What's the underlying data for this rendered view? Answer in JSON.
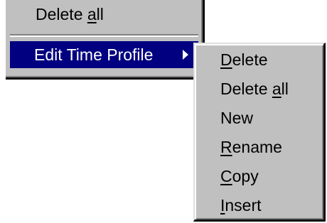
{
  "main_menu": {
    "delete_all": {
      "pre": "Delete ",
      "accel": "a",
      "post": "ll"
    },
    "edit_time_profile": {
      "label": "Edit Time Profile"
    }
  },
  "submenu": {
    "items": [
      {
        "pre": "",
        "accel": "D",
        "post": "elete"
      },
      {
        "pre": "Delete ",
        "accel": "a",
        "post": "ll"
      },
      {
        "pre": "New",
        "accel": "",
        "post": ""
      },
      {
        "pre": "",
        "accel": "R",
        "post": "ename"
      },
      {
        "pre": "",
        "accel": "C",
        "post": "opy"
      },
      {
        "pre": "",
        "accel": "I",
        "post": "nsert"
      }
    ]
  },
  "colors": {
    "menu_bg": "#c0c0c0",
    "highlight_bg": "#000080",
    "highlight_text": "#ffffff",
    "text": "#000000"
  },
  "icons": {
    "submenu_arrow": "triangle-right"
  }
}
